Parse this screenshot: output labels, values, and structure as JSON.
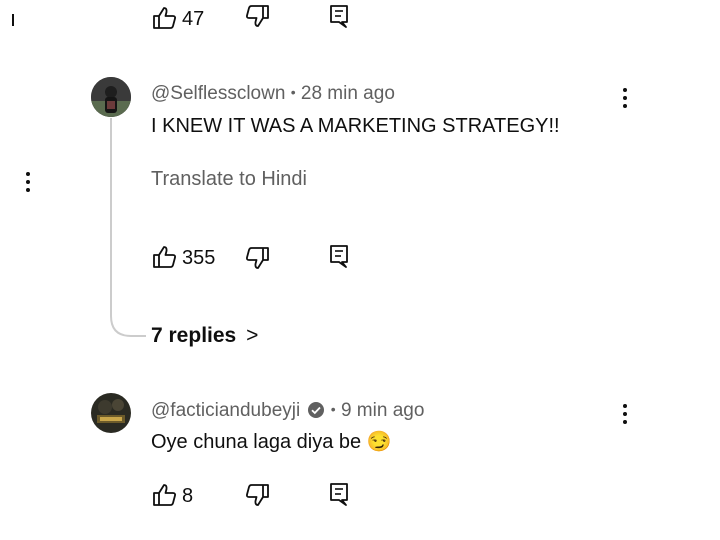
{
  "top_comment": {
    "like_count": "47"
  },
  "comment1": {
    "handle": "@Selflessclown",
    "separator": "•",
    "time": "28 min ago",
    "text": "I KNEW IT WAS A MARKETING STRATEGY!!",
    "translate_label": "Translate to Hindi",
    "like_count": "355",
    "replies_label": "7 replies",
    "replies_chevron": ">"
  },
  "comment2": {
    "handle": "@facticiandubeyji",
    "separator": "•",
    "time": "9 min ago",
    "text": "Oye chuna laga diya be",
    "emoji": "😏",
    "like_count": "8"
  },
  "icons": {
    "like": "thumbs-up-icon",
    "dislike": "thumbs-down-icon",
    "reply": "reply-comment-icon",
    "menu": "more-vert-icon",
    "verified": "verified-badge-icon"
  },
  "colors": {
    "primary_text": "#0f0f0f",
    "secondary_text": "#606060",
    "thread_line": "#cccccc"
  }
}
